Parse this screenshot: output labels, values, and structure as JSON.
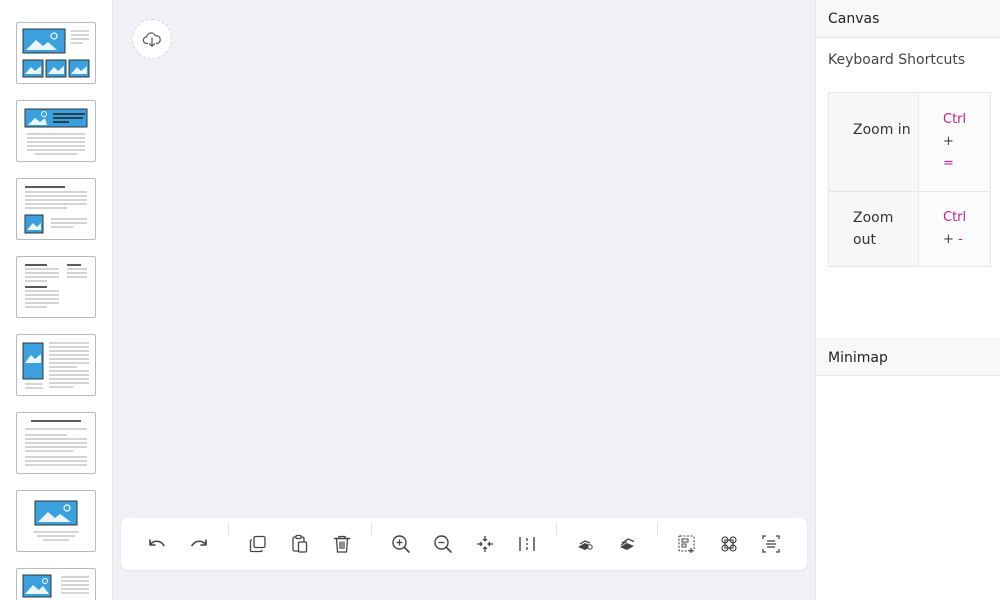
{
  "right_panel": {
    "canvas_title": "Canvas",
    "shortcuts_title": "Keyboard Shortcuts",
    "shortcuts": [
      {
        "name": "Zoom in",
        "key_mod": "Ctrl",
        "key_plus": "+",
        "key_main": "="
      },
      {
        "name": "Zoom out",
        "key_mod": "Ctrl",
        "key_plus": "+",
        "key_main": "-"
      }
    ],
    "minimap_title": "Minimap"
  },
  "sidebar": {
    "templates": [
      {
        "id": "template-image-grid"
      },
      {
        "id": "template-image-text-header"
      },
      {
        "id": "template-text-image"
      },
      {
        "id": "template-two-column-text"
      },
      {
        "id": "template-image-left-text"
      },
      {
        "id": "template-text-only"
      },
      {
        "id": "template-centered-image"
      },
      {
        "id": "template-image-text-bottom"
      }
    ]
  },
  "toolbar": {
    "icons": [
      "undo-icon",
      "redo-icon",
      "copy-icon",
      "paste-icon",
      "delete-icon",
      "zoom-in-icon",
      "zoom-out-icon",
      "fit-view-icon",
      "align-icon",
      "lock-icon",
      "unlock-icon",
      "group-icon",
      "ungroup-icon",
      "select-all-icon"
    ]
  },
  "colors": {
    "accent_blue": "#3aa0de",
    "shortcut_key": "#c0208a",
    "canvas_bg": "#f0f1f6"
  }
}
